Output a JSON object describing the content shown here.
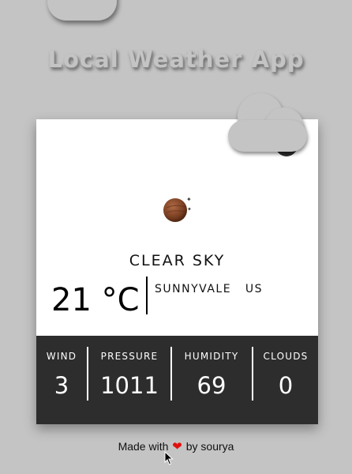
{
  "app_title": "Local Weather App",
  "weather": {
    "condition": "CLEAR SKY",
    "temperature": "21 °C",
    "city": "SUNNYVALE",
    "country": "US",
    "icon": "clear-sky-moon-icon"
  },
  "stats": [
    {
      "label": "WIND",
      "value": "3"
    },
    {
      "label": "PRESSURE",
      "value": "1011"
    },
    {
      "label": "HUMIDITY",
      "value": "69"
    },
    {
      "label": "CLOUDS",
      "value": "0"
    }
  ],
  "footer": {
    "prefix": "Made with",
    "heart": "❤",
    "suffix": "by sourya"
  },
  "colors": {
    "background": "#c4c4c4",
    "card": "#ffffff",
    "stats_bar": "#2d2d2d",
    "heart": "#e01010"
  }
}
